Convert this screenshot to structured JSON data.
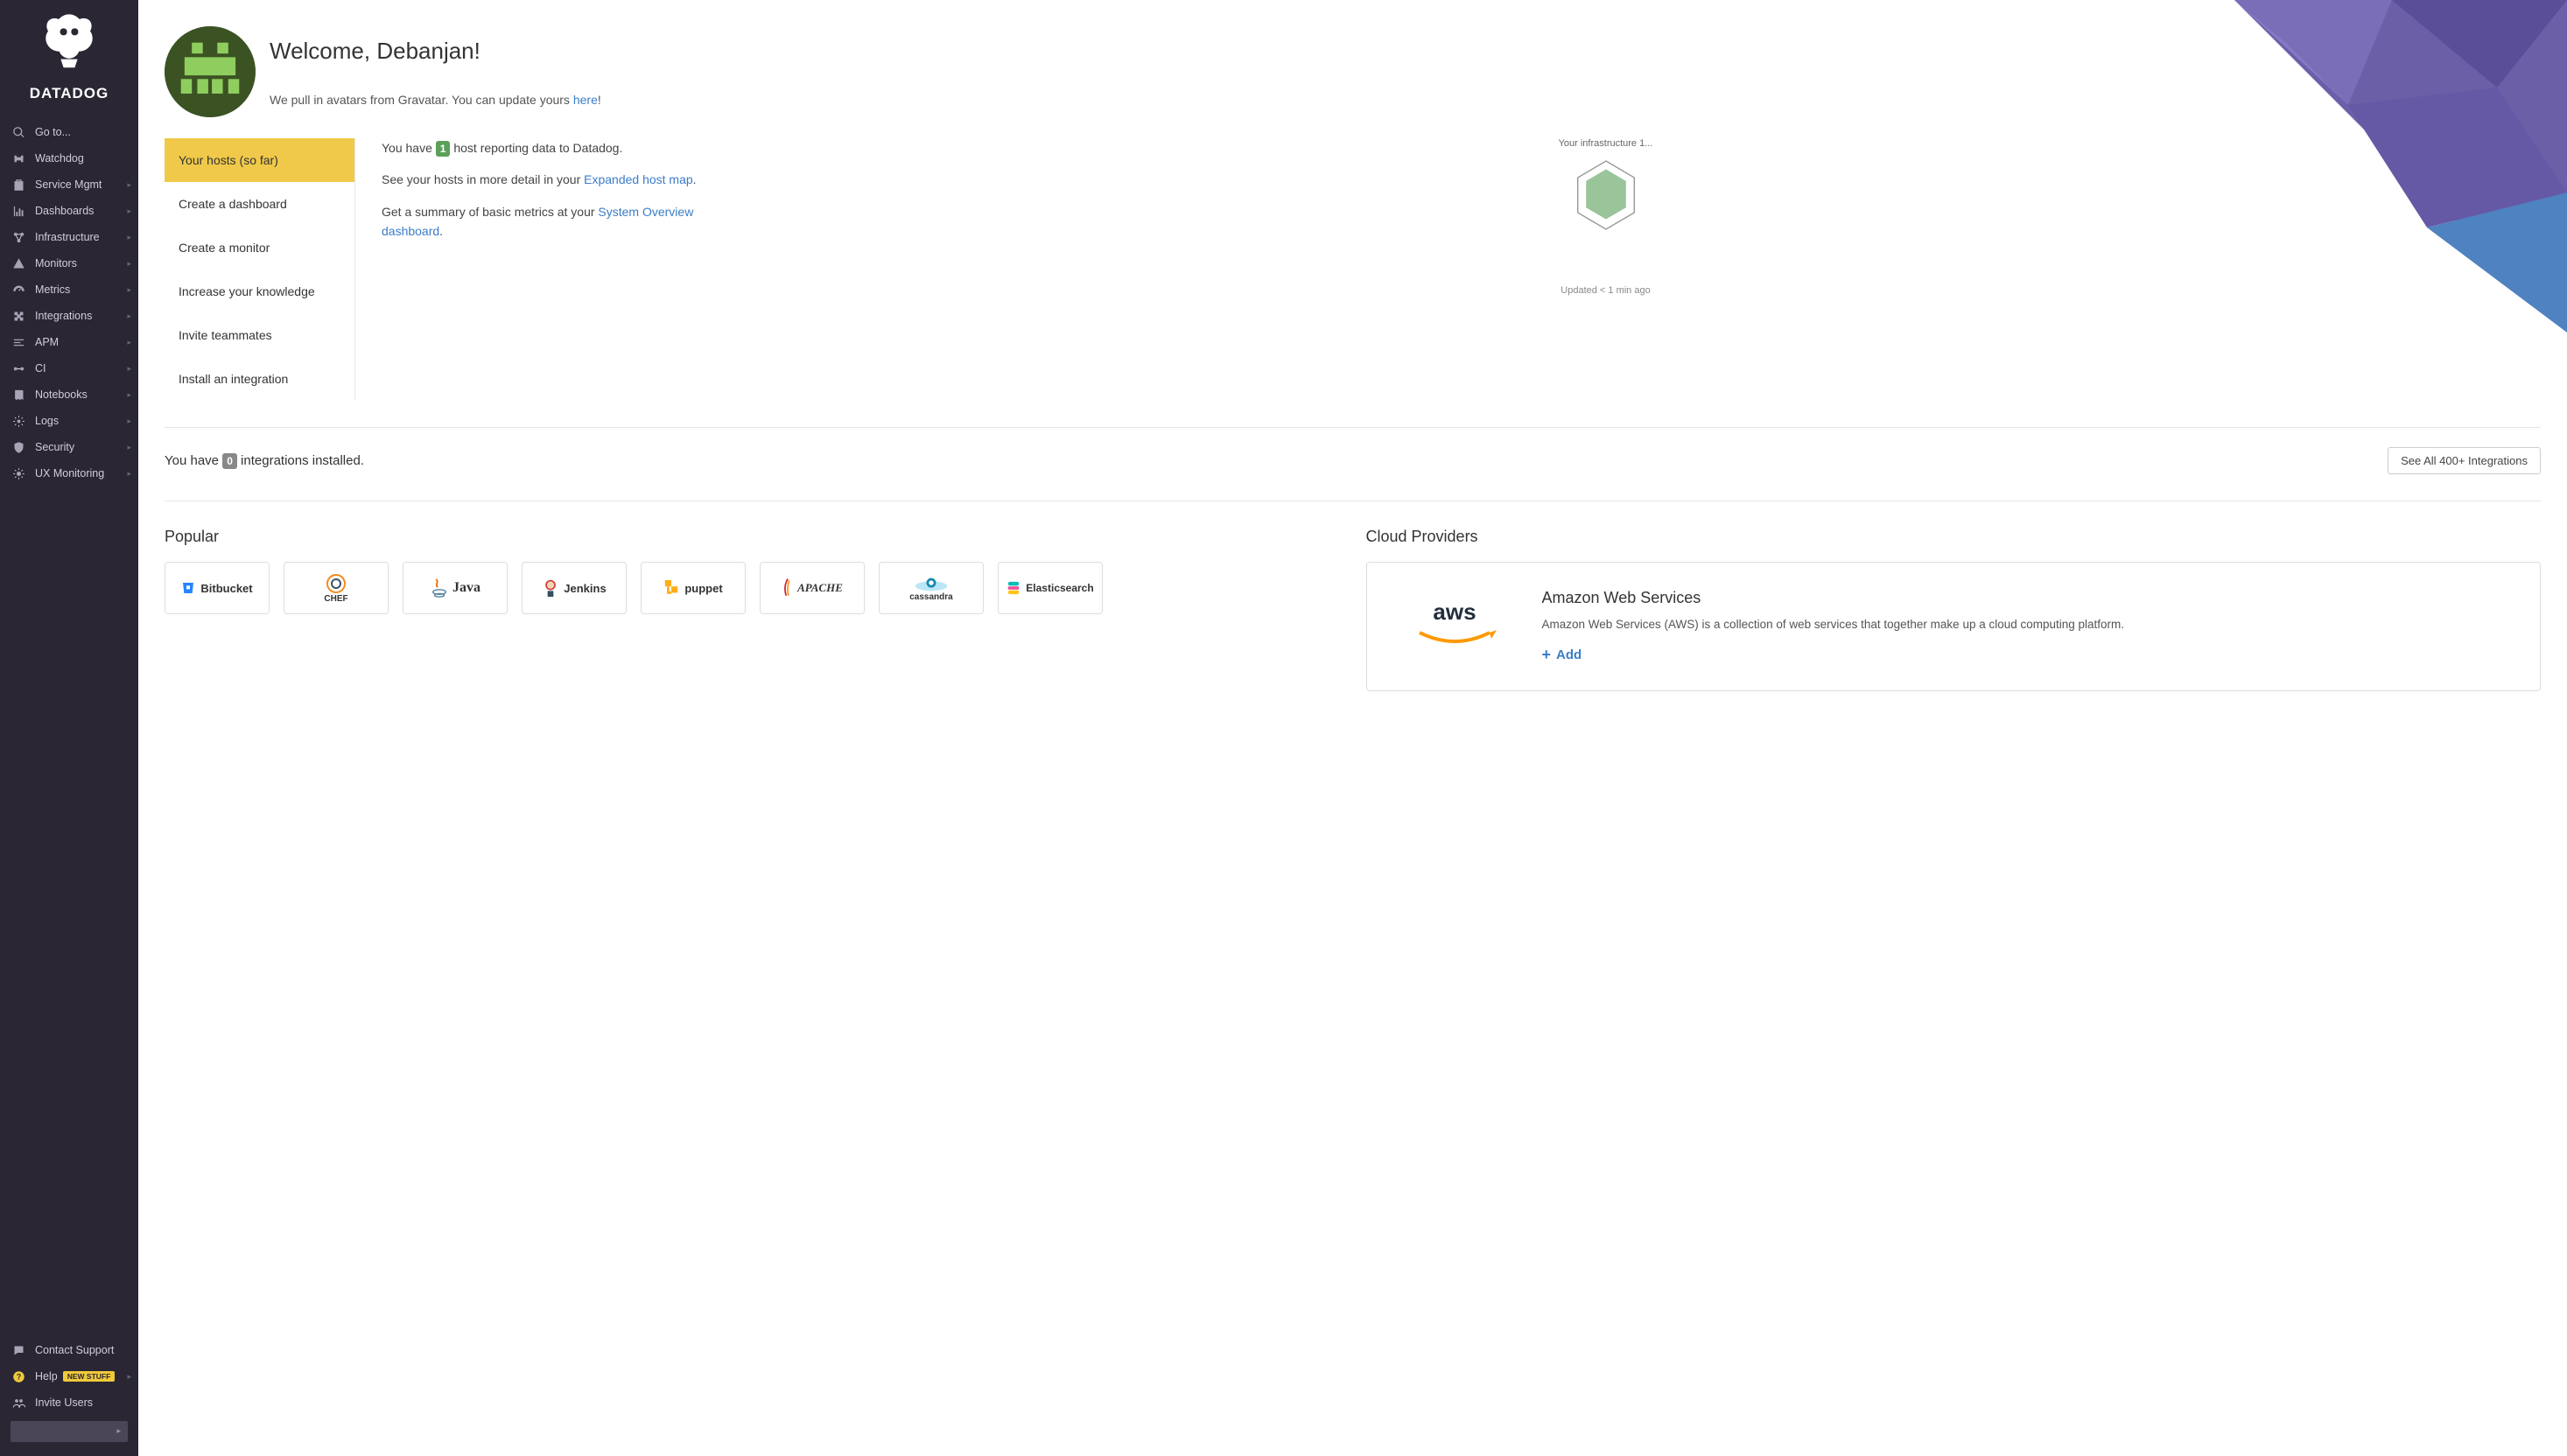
{
  "brand": "DATADOG",
  "sidebar": {
    "top": [
      {
        "label": "Go to...",
        "icon": "search-icon",
        "chev": false
      },
      {
        "label": "Watchdog",
        "icon": "binoculars-icon",
        "chev": false
      },
      {
        "label": "Service Mgmt",
        "icon": "clipboard-icon",
        "chev": true
      },
      {
        "label": "Dashboards",
        "icon": "chart-icon",
        "chev": true
      },
      {
        "label": "Infrastructure",
        "icon": "network-icon",
        "chev": true
      },
      {
        "label": "Monitors",
        "icon": "alert-icon",
        "chev": true
      },
      {
        "label": "Metrics",
        "icon": "gauge-icon",
        "chev": true
      },
      {
        "label": "Integrations",
        "icon": "puzzle-icon",
        "chev": true
      },
      {
        "label": "APM",
        "icon": "trace-icon",
        "chev": true
      },
      {
        "label": "CI",
        "icon": "pipeline-icon",
        "chev": true
      },
      {
        "label": "Notebooks",
        "icon": "book-icon",
        "chev": true
      },
      {
        "label": "Logs",
        "icon": "logs-icon",
        "chev": true
      },
      {
        "label": "Security",
        "icon": "shield-icon",
        "chev": true
      },
      {
        "label": "UX Monitoring",
        "icon": "ux-icon",
        "chev": true
      }
    ],
    "bottom": [
      {
        "label": "Contact Support",
        "icon": "chat-icon",
        "badge": ""
      },
      {
        "label": "Help",
        "icon": "help-icon",
        "badge": "NEW STUFF"
      },
      {
        "label": "Invite Users",
        "icon": "users-icon",
        "badge": ""
      }
    ]
  },
  "welcome": {
    "title": "Welcome, Debanjan!",
    "subtitle_pre": "We pull in avatars from Gravatar. You can update yours ",
    "subtitle_link": "here",
    "subtitle_post": "!"
  },
  "onboard": {
    "items": [
      "Your hosts (so far)",
      "Create a dashboard",
      "Create a monitor",
      "Increase your knowledge",
      "Invite teammates",
      "Install an integration"
    ],
    "active_index": 0,
    "content": {
      "line1_pre": "You have ",
      "host_count": "1",
      "line1_post": " host reporting data to Datadog.",
      "line2_pre": "See your hosts in more detail in your ",
      "line2_link": "Expanded host map",
      "line2_post": ".",
      "line3_pre": "Get a summary of basic metrics at your ",
      "line3_link": "System Overview dashboard",
      "line3_post": ".",
      "infra_label": "Your infrastructure 1...",
      "updated": "Updated < 1 min ago"
    }
  },
  "integrations": {
    "summary_pre": "You have ",
    "installed_count": "0",
    "summary_post": " integrations installed.",
    "see_all_btn": "See All 400+ Integrations",
    "popular_heading": "Popular",
    "popular": [
      "Bitbucket",
      "CHEF",
      "Java",
      "Jenkins",
      "puppet",
      "APACHE",
      "cassandra",
      "Elasticsearch"
    ],
    "cloud_heading": "Cloud Providers",
    "cloud_card": {
      "title": "Amazon Web Services",
      "desc": "Amazon Web Services (AWS) is a collection of web services that together make up a cloud computing platform.",
      "add_label": "Add",
      "logo_text": "aws"
    }
  }
}
